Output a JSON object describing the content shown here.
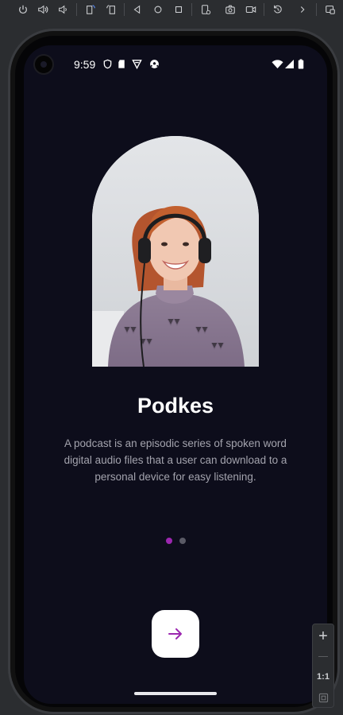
{
  "toolbar": {
    "buttons": [
      {
        "name": "power-icon"
      },
      {
        "name": "volume-up-icon"
      },
      {
        "name": "volume-down-icon"
      },
      {
        "name": "rotate-left-icon"
      },
      {
        "name": "rotate-right-icon"
      },
      {
        "name": "back-icon"
      },
      {
        "name": "home-icon"
      },
      {
        "name": "overview-icon"
      },
      {
        "name": "device-settings-icon"
      },
      {
        "name": "screenshot-icon"
      },
      {
        "name": "screen-record-icon"
      },
      {
        "name": "snapshot-icon"
      },
      {
        "name": "more-icon"
      },
      {
        "name": "window-icon"
      }
    ]
  },
  "status_bar": {
    "time": "9:59",
    "icons": [
      "shield-icon",
      "sd-card-icon",
      "vpn-icon",
      "soccer-icon",
      "wifi-icon",
      "signal-icon",
      "battery-icon"
    ]
  },
  "onboarding": {
    "title": "Podkes",
    "description": "A podcast is an episodic series of spoken word digital audio files that a user can download to a personal device for easy listening.",
    "page_count": 2,
    "active_page": 0,
    "next_icon": "arrow-right-icon"
  },
  "colors": {
    "background": "#0d0d1b",
    "accent": "#9c27b0",
    "dot_active": "#9c27b0",
    "dot_inactive": "#5a5a66",
    "button_bg": "#ffffff"
  },
  "zoom": {
    "zoom_in": "+",
    "ratio": "1:1"
  }
}
